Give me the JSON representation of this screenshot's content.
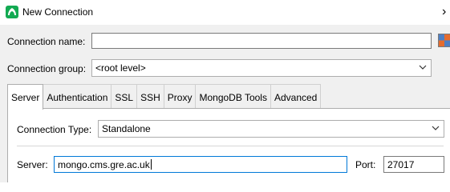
{
  "window": {
    "title": "New Connection",
    "close_glyph": "›",
    "app_icon": "mongodb-leaf-icon"
  },
  "form": {
    "connection_name_label": "Connection name:",
    "connection_name_value": "",
    "connection_group_label": "Connection group:",
    "connection_group_value": "<root level>"
  },
  "tabs": [
    {
      "label": "Server",
      "active": true
    },
    {
      "label": "Authentication",
      "active": false
    },
    {
      "label": "SSL",
      "active": false
    },
    {
      "label": "SSH",
      "active": false
    },
    {
      "label": "Proxy",
      "active": false
    },
    {
      "label": "MongoDB Tools",
      "active": false
    },
    {
      "label": "Advanced",
      "active": false
    }
  ],
  "server_tab": {
    "connection_type_label": "Connection Type:",
    "connection_type_value": "Standalone",
    "server_label": "Server:",
    "server_value": "mongo.cms.gre.ac.uk",
    "port_label": "Port:",
    "port_value": "27017"
  },
  "colors": {
    "app_accent": "#13aa52",
    "focus_border": "#0078d7",
    "dialog_background": "#f0f0f0"
  }
}
